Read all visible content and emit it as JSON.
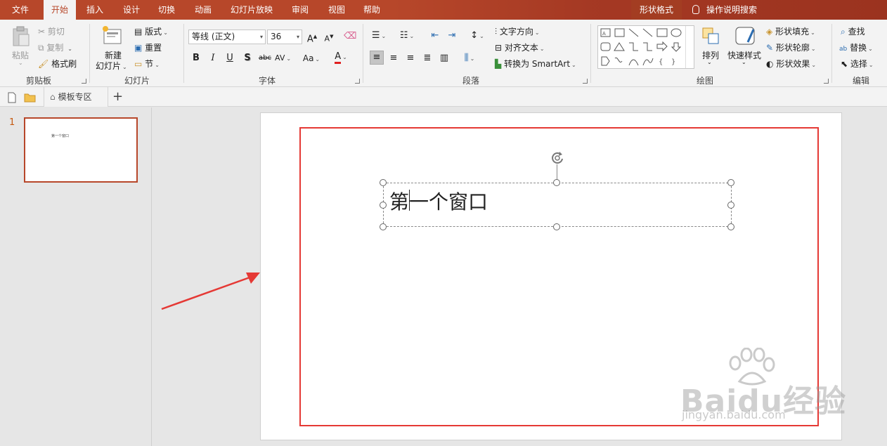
{
  "tabs": [
    {
      "label": "文件",
      "active": false
    },
    {
      "label": "开始",
      "active": true
    },
    {
      "label": "插入",
      "active": false
    },
    {
      "label": "设计",
      "active": false
    },
    {
      "label": "切换",
      "active": false
    },
    {
      "label": "动画",
      "active": false
    },
    {
      "label": "幻灯片放映",
      "active": false
    },
    {
      "label": "审阅",
      "active": false
    },
    {
      "label": "视图",
      "active": false
    },
    {
      "label": "帮助",
      "active": false
    },
    {
      "label": "形状格式",
      "active": false
    }
  ],
  "tell_me": "操作说明搜索",
  "ribbon": {
    "clipboard": {
      "paste": "粘贴",
      "cut": "剪切",
      "copy": "复制",
      "format_painter": "格式刷",
      "label": "剪贴板"
    },
    "slides": {
      "new_slide_line1": "新建",
      "new_slide_line2": "幻灯片",
      "layout": "版式",
      "reset": "重置",
      "section": "节",
      "label": "幻灯片"
    },
    "font": {
      "name": "等线 (正文)",
      "size": "36",
      "bold": "B",
      "italic": "I",
      "underline": "U",
      "shadow": "S",
      "strike": "abc",
      "spacing": "AV",
      "case": "Aa",
      "color_a": "A",
      "grow": "A",
      "shrink": "A",
      "label": "字体"
    },
    "paragraph": {
      "text_direction": "文字方向",
      "align_text": "对齐文本",
      "smartart": "转换为 SmartArt",
      "label": "段落"
    },
    "drawing": {
      "arrange": "排列",
      "quick_styles": "快速样式",
      "fill": "形状填充",
      "outline": "形状轮廓",
      "effects": "形状效果",
      "label": "绘图"
    },
    "editing": {
      "find": "查找",
      "replace": "替换",
      "select": "选择",
      "label": "编辑"
    }
  },
  "quick_access": {
    "template_tab": "模板专区"
  },
  "slide_panel": {
    "number": "1",
    "thumb_text": "第一个窗口"
  },
  "slide": {
    "text": "第一个窗口"
  },
  "watermark": {
    "main": "Baidu经验",
    "sub": "jingyan.baidu.com"
  },
  "colors": {
    "accent": "#b7472a",
    "annotation_red": "#e53935"
  }
}
